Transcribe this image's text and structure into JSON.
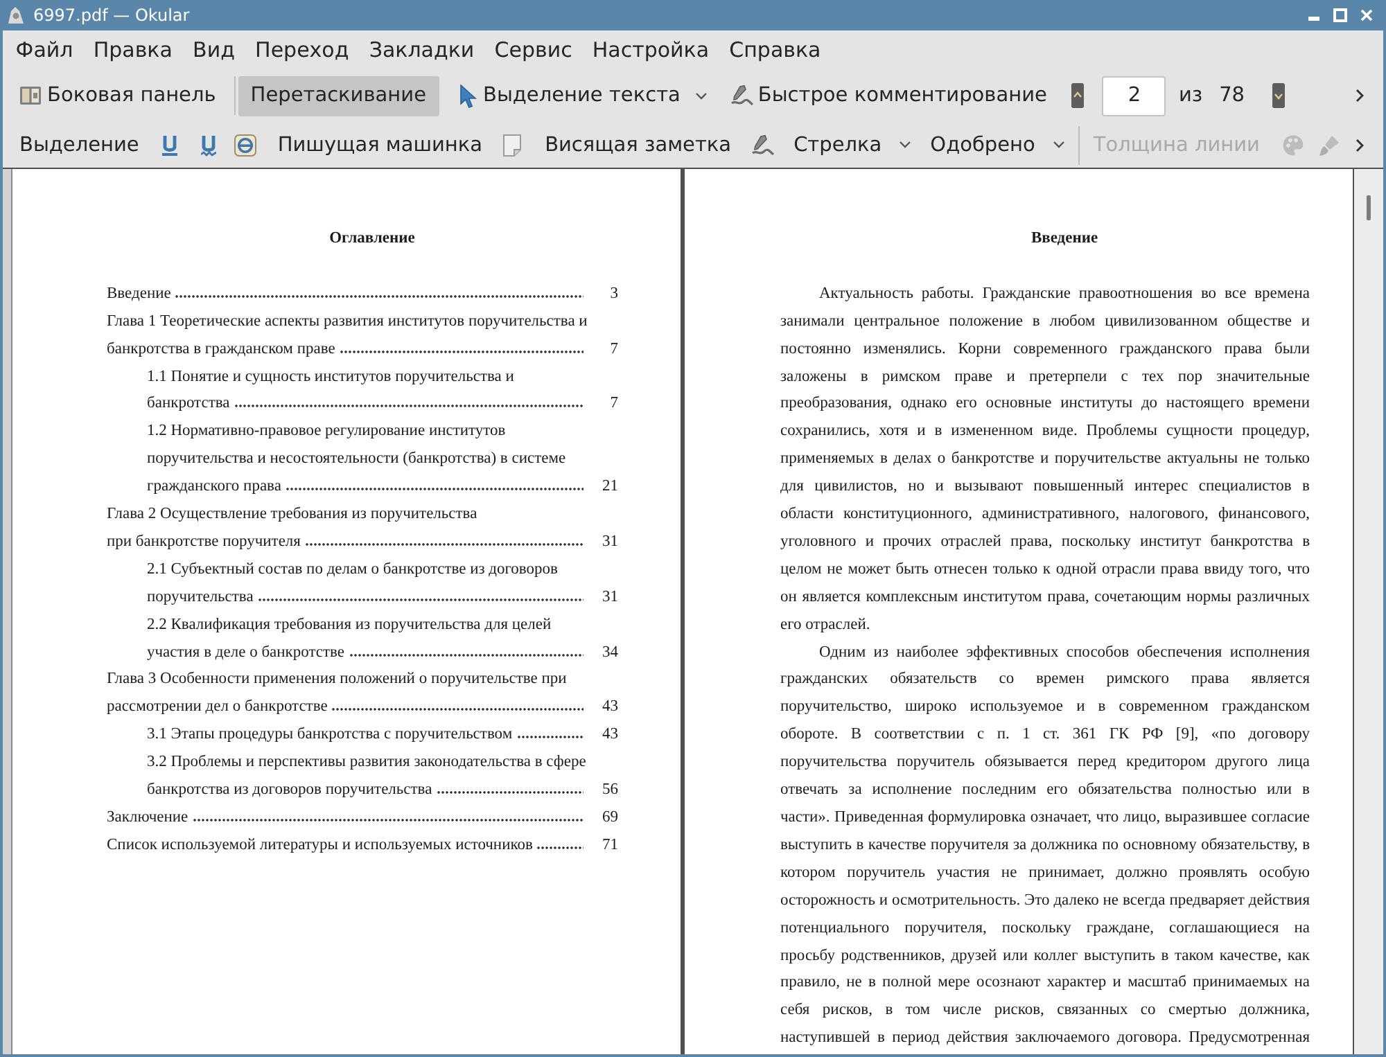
{
  "window": {
    "title": "6997.pdf — Okular"
  },
  "menu": [
    "Файл",
    "Правка",
    "Вид",
    "Переход",
    "Закладки",
    "Сервис",
    "Настройка",
    "Справка"
  ],
  "main_toolbar": {
    "sidebar": {
      "label": "Боковая панель"
    },
    "modes": [
      {
        "label": "Перетаскивание",
        "selected": true
      },
      {
        "label": "Выделение текста",
        "selected": false
      }
    ],
    "quick_annotations": {
      "label": "Быстрое комментирование"
    },
    "page_field": {
      "value": "2"
    },
    "page_of": "из",
    "page_total": "78"
  },
  "annotation_toolbar": {
    "items": [
      {
        "kind": "text",
        "label": "Выделение",
        "disabled": false
      },
      {
        "kind": "icon",
        "disabled": false
      },
      {
        "kind": "icon",
        "disabled": false
      },
      {
        "kind": "icon",
        "disabled": false
      },
      {
        "kind": "text",
        "label": "Пишущая машинка",
        "disabled": false
      },
      {
        "kind": "icon",
        "disabled": false
      },
      {
        "kind": "text",
        "label": "Висящая заметка",
        "disabled": false
      },
      {
        "kind": "icon",
        "disabled": false
      },
      {
        "kind": "dropdown",
        "label": "Стрелка",
        "disabled": false
      },
      {
        "kind": "dropdown",
        "label": "Одобрено",
        "disabled": false
      },
      {
        "kind": "separator",
        "disabled": false
      },
      {
        "kind": "text",
        "label": "Толщина линии",
        "disabled": true
      },
      {
        "kind": "icon",
        "disabled": true
      },
      {
        "kind": "icon",
        "disabled": true
      }
    ]
  },
  "document": {
    "pages": [
      {
        "kind": "contents",
        "heading": "Оглавление",
        "entries": [
          {
            "title": "Введение",
            "page": "3"
          },
          {
            "title": "Глава 1 Теоретические аспекты развития институтов поручительства и\nбанкротства в гражданском праве",
            "page": "7",
            "children": [
              {
                "title": "1.1 Понятие и сущность институтов поручительства и\nбанкротства",
                "page": "7"
              },
              {
                "title": "1.2 Нормативно-правовое регулирование институтов\nпоручительства и несостоятельности (банкротства) в системе\nгражданского права",
                "page": "21"
              }
            ]
          },
          {
            "title": "Глава 2 Осуществление требования из поручительства\nпри банкротстве поручителя",
            "page": "31",
            "children": [
              {
                "title": "2.1 Субъектный состав по делам о банкротстве из договоров\nпоручительства",
                "page": "31"
              },
              {
                "title": "2.2 Квалификация требования из поручительства для целей\nучастия в деле о банкротстве",
                "page": "34"
              }
            ]
          },
          {
            "title": "Глава 3 Особенности применения положений о поручительстве при\nрассмотрении дел о банкротстве",
            "page": "43",
            "children": [
              {
                "title": "3.1 Этапы процедуры банкротства с поручительством",
                "page": "43"
              },
              {
                "title": "3.2 Проблемы и перспективы развития законодательства в сфере\nбанкротства из договоров поручительства",
                "page": "56"
              }
            ]
          },
          {
            "title": "Заключение",
            "page": "69"
          },
          {
            "title": "Список используемой литературы и используемых источников",
            "page": "71"
          }
        ]
      },
      {
        "kind": "text",
        "heading": "Введение",
        "paragraphs": [
          {
            "text": "Актуальность работы. Гражданские правоотношения во все времена занимали центральное положение в любом цивилизованном обществе и постоянно изменялись. Корни современного гражданского права были заложены в римском праве и претерпели с тех пор значительные преобразования, однако его основные институты до настоящего времени сохранились, хотя и в измененном виде. Проблемы сущности процедур, применяемых в делах о банкротстве и поручительстве актуальны не только для цивилистов, но и вызывают повышенный интерес специалистов в области конституционного, административного, налогового, финансового, уголовного и прочих отраслей права, поскольку институт банкротства в целом не может быть отнесен только к одной отрасли права ввиду того, что он является комплексным институтом права, сочетающим нормы различных его отраслей.",
            "continues": false
          },
          {
            "text": "Одним из наиболее эффективных способов обеспечения исполнения гражданских обязательств со времен римского права является поручительство, широко используемое и в современном гражданском обороте. В соответствии с п. 1 ст. 361 ГК РФ [9], «по договору поручительства поручитель обязывается перед кредитором другого лица отвечать за исполнение последним его обязательства полностью или в части». Приведенная формулировка означает, что лицо, выразившее согласие выступить в качестве поручителя за должника по основному обязательству, в котором поручитель участия не принимает, должно проявлять особую осторожность и осмотрительность. Это далеко не всегда предваряет действия потенциального поручителя, поскольку граждане, соглашающиеся на просьбу родственников, друзей или коллег выступить в таком качестве, как правило, не в полной мере осознают характер и масштаб принимаемых на себя рисков, в том числе рисков, связанных со смертью должника, наступившей в период действия заключаемого договора. Предусмотренная",
            "continues": true
          }
        ]
      }
    ]
  }
}
